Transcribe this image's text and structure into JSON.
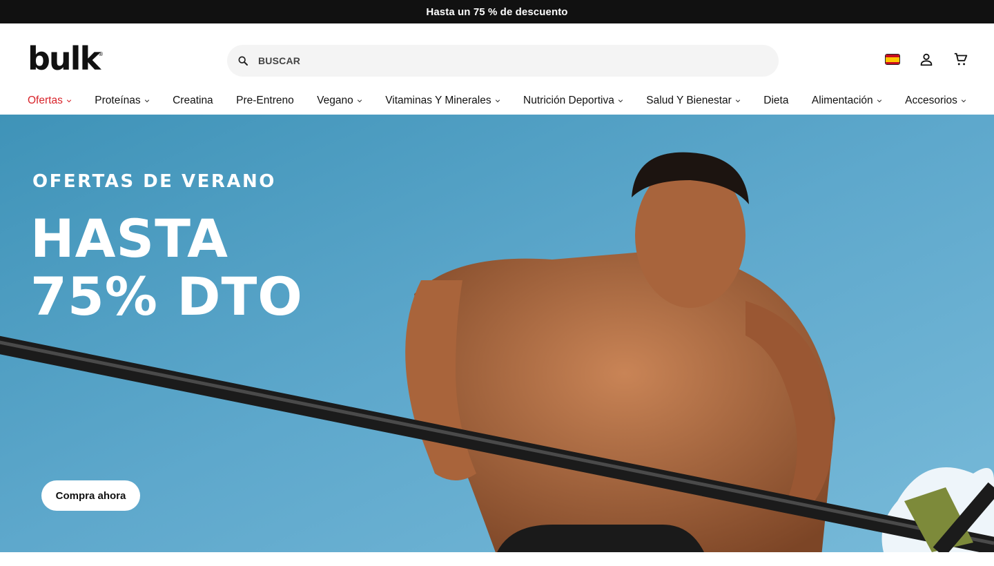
{
  "promo_bar": {
    "text": "Hasta un 75 % de descuento"
  },
  "header": {
    "logo": "bulk",
    "logo_mark": "®",
    "search": {
      "placeholder": "BUSCAR",
      "value": ""
    },
    "icons": [
      "spain-flag-icon",
      "account-icon",
      "cart-icon"
    ]
  },
  "nav": {
    "items": [
      {
        "label": "Ofertas",
        "dropdown": true,
        "active": true
      },
      {
        "label": "Proteínas",
        "dropdown": true
      },
      {
        "label": "Creatina",
        "dropdown": false
      },
      {
        "label": "Pre-Entreno",
        "dropdown": false
      },
      {
        "label": "Vegano",
        "dropdown": true
      },
      {
        "label": "Vitaminas Y Minerales",
        "dropdown": true
      },
      {
        "label": "Nutrición Deportiva",
        "dropdown": true
      },
      {
        "label": "Salud Y Bienestar",
        "dropdown": true
      },
      {
        "label": "Dieta",
        "dropdown": false
      },
      {
        "label": "Alimentación",
        "dropdown": true
      },
      {
        "label": "Accesorios",
        "dropdown": true
      }
    ]
  },
  "hero": {
    "eyebrow": "OFERTAS DE VERANO",
    "headline_line1": "HASTA",
    "headline_line2": "75% DTO",
    "cta_label": "Compra ahora"
  },
  "colors": {
    "promo_bg": "#111111",
    "accent_red": "#d8232a",
    "sky": "#5aa3c8",
    "search_bg": "#f4f4f4"
  }
}
